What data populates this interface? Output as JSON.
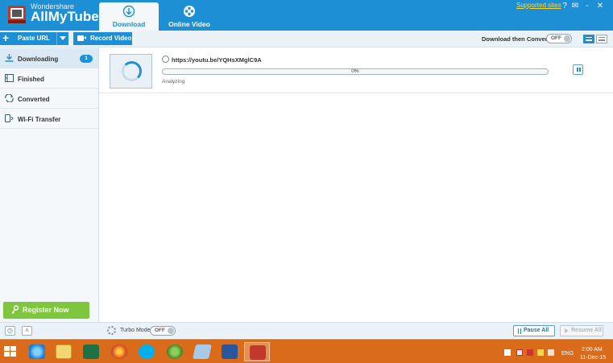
{
  "app": {
    "brand_small": "Wondershare",
    "brand_name": "AllMyTube",
    "supported_sites": "Supported sites",
    "window_controls": [
      "?",
      "✉",
      "-",
      "✕"
    ]
  },
  "tabs": [
    {
      "label": "Download",
      "icon": "download-icon"
    },
    {
      "label": "Online Video",
      "icon": "film-reel-icon"
    }
  ],
  "toolbar": {
    "paste_url": "Paste URL",
    "record_video": "Record Video",
    "download_then_convert": "Download then Convert",
    "convert_toggle": "OFF"
  },
  "sidebar": {
    "items": [
      {
        "label": "Downloading",
        "icon": "download-arrow-icon",
        "badge": "1",
        "active": true
      },
      {
        "label": "Finished",
        "icon": "film-strip-icon"
      },
      {
        "label": "Converted",
        "icon": "convert-icon"
      },
      {
        "label": "Wi-Fi Transfer",
        "icon": "phone-icon"
      }
    ],
    "register": "Register Now",
    "bottom_buttons": [
      "clock-icon",
      "chevron-up-icon"
    ]
  },
  "download": {
    "url": "https://youtu.be/YQHsXMglC9A",
    "progress_text": "0%",
    "progress": 0,
    "status": "Analyzing"
  },
  "bottom": {
    "turbo_label": "Turbo Mode:",
    "turbo_toggle": "OFF",
    "pause_all": "Pause All",
    "resume_all": "Resume All"
  },
  "taskbar": {
    "apps": [
      "internet-explorer-icon",
      "file-explorer-icon",
      "excel-icon",
      "firefox-icon",
      "skype-icon",
      "idm-icon",
      "notes-icon",
      "word-icon",
      "allmytube-icon"
    ],
    "language": "ENG",
    "time": "2:00 AM",
    "date": "11-Dec-15"
  },
  "colors": {
    "accent": "#1d8fd4",
    "register_green": "#7ec63e",
    "taskbar_orange": "#d96b1b",
    "supported_sites": "#ffd733"
  }
}
